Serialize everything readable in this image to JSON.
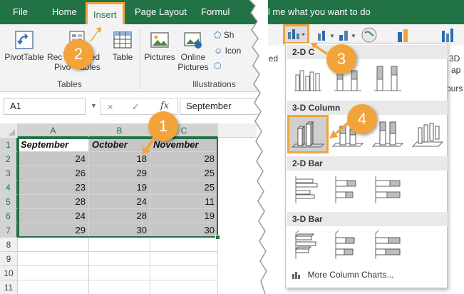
{
  "tabs": {
    "file": "File",
    "home": "Home",
    "insert": "Insert",
    "page_layout": "Page Layout",
    "formulas_partial": "Formul",
    "tell_me_partial": "ll me what you want to do"
  },
  "ribbon": {
    "pivot_table": "PivotTable",
    "recommended_partial": "Rec",
    "pivottables_partial": "Pivo",
    "ded_partial": "ded",
    "tables_suffix": "ables",
    "table": "Table",
    "pictures": "Pictures",
    "online_pictures_1": "Online",
    "online_pictures_2": "Pictures",
    "shapes_partial": "Sh",
    "icons_partial": "Icon",
    "group_tables": "Tables",
    "group_illustrations": "Illustrations",
    "right_ded": "ded",
    "right_3d": "3D",
    "right_map": "ap",
    "right_tours": "ours"
  },
  "formula_bar": {
    "name_box": "A1",
    "cancel_icon": "×",
    "enter_icon": "✓",
    "fx": "fx",
    "content": "September"
  },
  "grid": {
    "columns": [
      "A",
      "B",
      "C"
    ],
    "rows": [
      "1",
      "2",
      "3",
      "4",
      "5",
      "6",
      "7",
      "8",
      "9",
      "10",
      "11"
    ],
    "headers": [
      "September",
      "October",
      "November"
    ],
    "data": [
      [
        24,
        18,
        28
      ],
      [
        26,
        29,
        25
      ],
      [
        23,
        19,
        25
      ],
      [
        28,
        24,
        11
      ],
      [
        24,
        28,
        19
      ],
      [
        29,
        30,
        30
      ]
    ]
  },
  "dropdown": {
    "sec_2d_column": "2-D C",
    "sec_3d_column": "3-D Column",
    "sec_2d_bar": "2-D Bar",
    "sec_3d_bar": "3-D Bar",
    "more": "More Column Charts..."
  },
  "steps": [
    "1",
    "2",
    "3",
    "4"
  ],
  "colors": {
    "excel_green": "#217346",
    "highlight_orange": "#f2a33a",
    "selection_fill": "#c6c6c6"
  }
}
